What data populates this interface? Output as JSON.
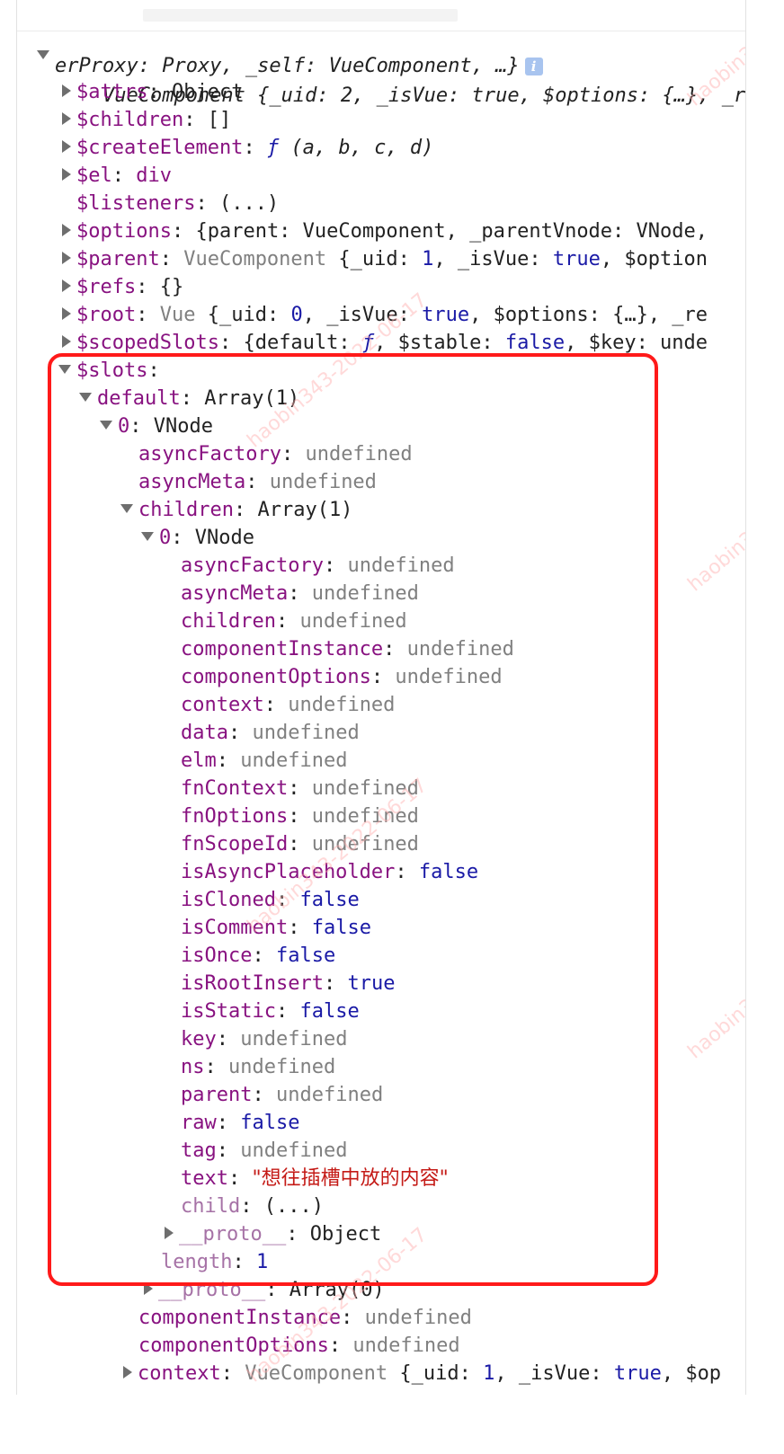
{
  "header": {
    "line1": "VueComponent {_uid: 2, _isVue: true, $options: {…}, _re",
    "line2": "erProxy: Proxy, _self: VueComponent, …}",
    "info_glyph": "i"
  },
  "rows": {
    "attrs": {
      "key": "$attrs",
      "value": "Object"
    },
    "children": {
      "key": "$children",
      "value": "[]"
    },
    "createElement": {
      "key": "$createElement",
      "f": "ƒ",
      "value": "(a, b, c, d)"
    },
    "el": {
      "key": "$el",
      "value": "div"
    },
    "listeners": {
      "key": "$listeners",
      "value": "(...)"
    },
    "options": {
      "key": "$options",
      "value": "{parent: VueComponent, _parentVnode: VNode,"
    },
    "parent": {
      "key": "$parent",
      "v1": "VueComponent",
      "v2": "{_uid: ",
      "n": "1",
      "v3": ", _isVue: ",
      "b": "true",
      "v4": ", $option"
    },
    "refs": {
      "key": "$refs",
      "value": "{}"
    },
    "root": {
      "key": "$root",
      "v1": "Vue",
      "v2": "{_uid: ",
      "n": "0",
      "v3": ", _isVue: ",
      "b": "true",
      "v4": ", $options: {…}, _re"
    },
    "scopedSlots": {
      "key": "$scopedSlots",
      "v1": "{default: ",
      "f": "ƒ",
      "v2": ", $stable: ",
      "b": "false",
      "v3": ", $key: unde"
    },
    "slots": {
      "key": "$slots"
    },
    "default": {
      "key": "default",
      "value": "Array(1)"
    },
    "zero": {
      "key": "0",
      "value": "VNode"
    },
    "asyncFactory": {
      "key": "asyncFactory",
      "value": "undefined"
    },
    "asyncMeta": {
      "key": "asyncMeta",
      "value": "undefined"
    },
    "childrenArr": {
      "key": "children",
      "value": "Array(1)"
    },
    "zero2": {
      "key": "0",
      "value": "VNode"
    },
    "inner": [
      {
        "key": "asyncFactory",
        "value": "undefined",
        "type": "u"
      },
      {
        "key": "asyncMeta",
        "value": "undefined",
        "type": "u"
      },
      {
        "key": "children",
        "value": "undefined",
        "type": "u"
      },
      {
        "key": "componentInstance",
        "value": "undefined",
        "type": "u"
      },
      {
        "key": "componentOptions",
        "value": "undefined",
        "type": "u"
      },
      {
        "key": "context",
        "value": "undefined",
        "type": "u"
      },
      {
        "key": "data",
        "value": "undefined",
        "type": "u"
      },
      {
        "key": "elm",
        "value": "undefined",
        "type": "u"
      },
      {
        "key": "fnContext",
        "value": "undefined",
        "type": "u"
      },
      {
        "key": "fnOptions",
        "value": "undefined",
        "type": "u"
      },
      {
        "key": "fnScopeId",
        "value": "undefined",
        "type": "u"
      },
      {
        "key": "isAsyncPlaceholder",
        "value": "false",
        "type": "b"
      },
      {
        "key": "isCloned",
        "value": "false",
        "type": "b"
      },
      {
        "key": "isComment",
        "value": "false",
        "type": "b"
      },
      {
        "key": "isOnce",
        "value": "false",
        "type": "b"
      },
      {
        "key": "isRootInsert",
        "value": "true",
        "type": "b"
      },
      {
        "key": "isStatic",
        "value": "false",
        "type": "b"
      },
      {
        "key": "key",
        "value": "undefined",
        "type": "u"
      },
      {
        "key": "ns",
        "value": "undefined",
        "type": "u"
      },
      {
        "key": "parent",
        "value": "undefined",
        "type": "u"
      },
      {
        "key": "raw",
        "value": "false",
        "type": "b"
      },
      {
        "key": "tag",
        "value": "undefined",
        "type": "u"
      }
    ],
    "text": {
      "key": "text",
      "value": "\"想往插槽中放的内容\""
    },
    "child": {
      "key": "child",
      "value": "(...)"
    },
    "proto1": {
      "key": "__proto__",
      "value": "Object"
    },
    "length": {
      "key": "length",
      "value": "1"
    },
    "proto2": {
      "key": "__proto__",
      "value": "Array(0)"
    },
    "componentInstance": {
      "key": "componentInstance",
      "value": "undefined"
    },
    "componentOptions": {
      "key": "componentOptions",
      "value": "undefined"
    },
    "context": {
      "key": "context",
      "v1": "VueComponent",
      "v2": "{_uid: ",
      "n": "1",
      "v3": ", _isVue: ",
      "b": "true",
      "v4": ", $op"
    }
  },
  "watermark": "haobin343-2022-06-17",
  "colors": {
    "highlight_border": "#ff1a1a",
    "key_purple": "#881280",
    "bool_blue": "#1a1aa6",
    "string_red": "#c41a16",
    "undefined_gray": "#808080"
  }
}
